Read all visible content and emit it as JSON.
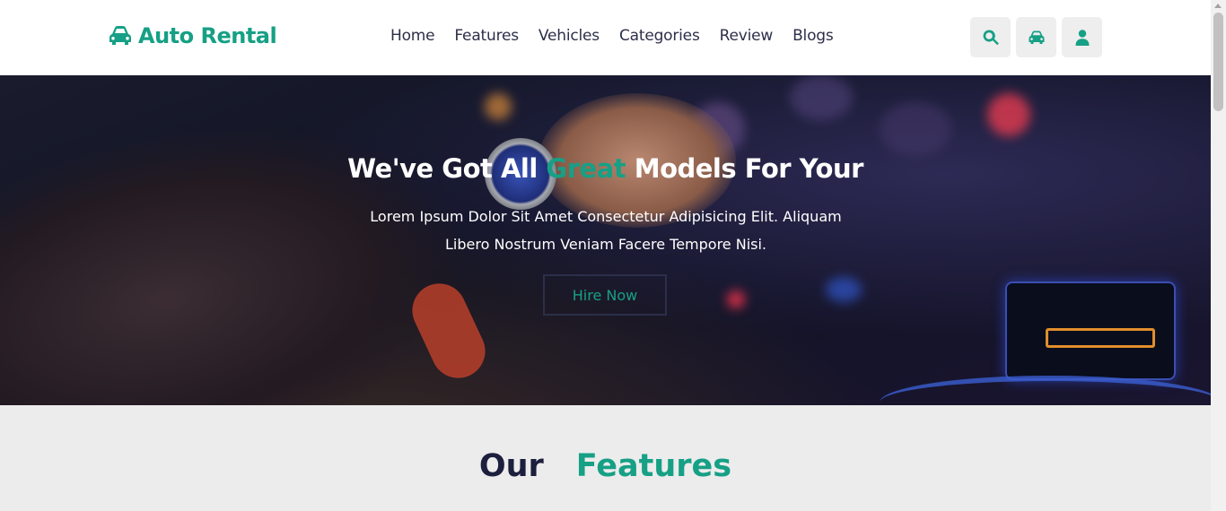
{
  "brand": {
    "name": "Auto Rental",
    "icon": "car-icon"
  },
  "nav": {
    "items": [
      {
        "label": "Home"
      },
      {
        "label": "Features"
      },
      {
        "label": "Vehicles"
      },
      {
        "label": "Categories"
      },
      {
        "label": "Review"
      },
      {
        "label": "Blogs"
      }
    ]
  },
  "header_buttons": [
    {
      "icon": "search-icon"
    },
    {
      "icon": "car-icon"
    },
    {
      "icon": "user-icon"
    }
  ],
  "hero": {
    "title_part1": "We've Got All",
    "title_accent": "Great",
    "title_part2": "Models For Your",
    "subtitle": "Lorem Ipsum Dolor Sit Amet Consectetur Adipisicing Elit. Aliquam Libero Nostrum Veniam Facere Tempore Nisi.",
    "cta_label": "Hire Now"
  },
  "features_section": {
    "title_word1": "Our",
    "title_word2": "Features"
  },
  "colors": {
    "accent": "#16a085",
    "dark": "#1c1f3d",
    "header_bg": "#ffffff",
    "section_bg": "#ececec"
  }
}
